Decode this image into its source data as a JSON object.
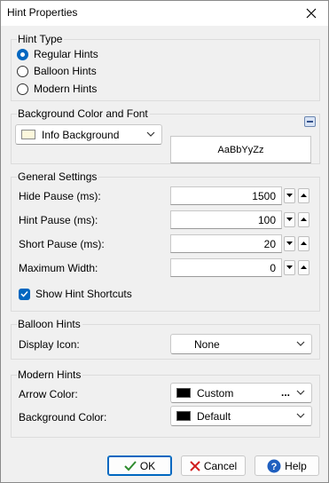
{
  "dialog": {
    "title": "Hint Properties"
  },
  "hint_type": {
    "title": "Hint Type",
    "options": [
      {
        "label": "Regular Hints",
        "selected": true
      },
      {
        "label": "Balloon Hints",
        "selected": false
      },
      {
        "label": "Modern Hints",
        "selected": false
      }
    ]
  },
  "background": {
    "title": "Background Color and Font",
    "color_label": "Info Background",
    "color_swatch": "#fdf8dc",
    "font_preview": "AaBbYyZz"
  },
  "general": {
    "title": "General Settings",
    "hide_pause": {
      "label": "Hide Pause (ms):",
      "value": "1500"
    },
    "hint_pause": {
      "label": "Hint Pause (ms):",
      "value": "100"
    },
    "short_pause": {
      "label": "Short Pause (ms):",
      "value": "20"
    },
    "max_width": {
      "label": "Maximum Width:",
      "value": "0"
    },
    "show_shortcuts": {
      "label": "Show Hint Shortcuts",
      "checked": true
    }
  },
  "balloon": {
    "title": "Balloon Hints",
    "display_icon_label": "Display Icon:",
    "display_icon_value": "None"
  },
  "modern": {
    "title": "Modern Hints",
    "arrow_color_label": "Arrow Color:",
    "arrow_color_value": "Custom",
    "arrow_color_swatch": "#000000",
    "ellipsis": "...",
    "bg_color_label": "Background Color:",
    "bg_color_value": "Default",
    "bg_color_swatch": "#000000"
  },
  "buttons": {
    "ok": "OK",
    "cancel": "Cancel",
    "help": "Help"
  },
  "colors": {
    "accent": "#0067c0",
    "cancel_red": "#d11f1f",
    "help_blue": "#1f5fbf",
    "ok_green": "#2e8b2e"
  }
}
